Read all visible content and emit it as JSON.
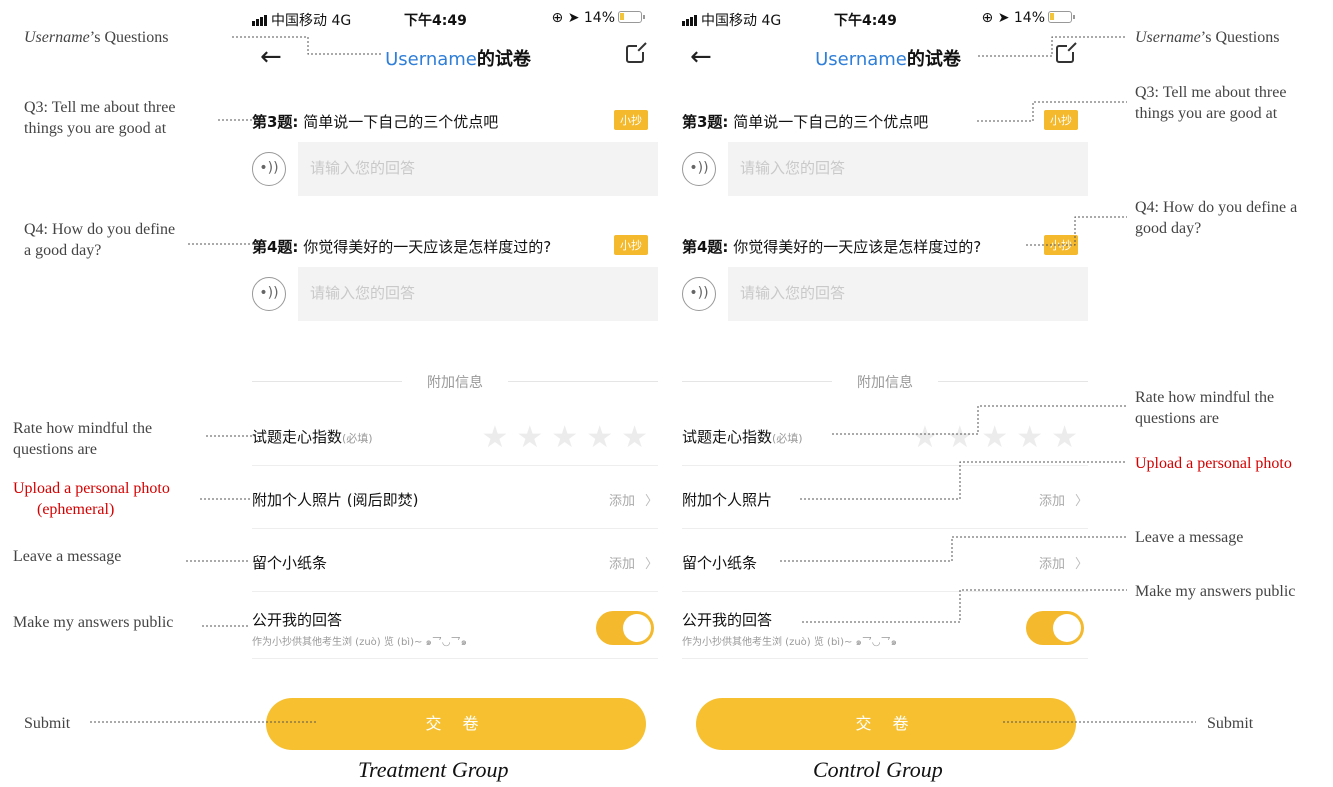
{
  "status_bar": {
    "carrier": "中国移动",
    "network": "4G",
    "time": "下午4:49",
    "battery": "14%",
    "icons": [
      "signal-icon",
      "lock-rotation-icon",
      "location-arrow-icon",
      "battery-icon"
    ]
  },
  "nav": {
    "back_icon": "arrow-left-icon",
    "title_username": "Username",
    "title_suffix": "的试卷",
    "share_icon": "share-icon"
  },
  "questions": [
    {
      "num": "第3题:",
      "text": "简单说一下自己的三个优点吧",
      "tag": "小抄",
      "placeholder": "请输入您的回答"
    },
    {
      "num": "第4题:",
      "text": "你觉得美好的一天应该是怎样度过的?",
      "tag": "小抄",
      "placeholder": "请输入您的回答"
    }
  ],
  "divider": "附加信息",
  "treatment": {
    "rating_label": "试题走心指数",
    "rating_required": "(必填)",
    "photo_label": "附加个人照片 (阅后即焚)",
    "photo_action": "添加",
    "message_label": "留个小纸条",
    "message_action": "添加",
    "public_label": "公开我的回答",
    "public_sub": "作为小抄供其他考生浏 (zuò) 览 (bì)~ ๑乛◡乛๑",
    "submit": "交 卷",
    "caption": "Treatment Group"
  },
  "control": {
    "rating_label": "试题走心指数",
    "rating_required": "(必填)",
    "photo_label": "附加个人照片",
    "photo_action": "添加",
    "message_label": "留个小纸条",
    "message_action": "添加",
    "public_label": "公开我的回答",
    "public_sub": "作为小抄供其他考生浏 (zuò) 览 (bì)~ ๑乛◡乛๑",
    "submit": "交 卷",
    "caption": "Control Group"
  },
  "annotations_left": {
    "title_italic": "Username",
    "title_rest": "’s Questions",
    "q3": "Q3: Tell me about three things you are good at",
    "q4": "Q4: How do you define a good day?",
    "rate": "Rate how mindful the questions are",
    "upload_line1": "Upload a personal photo",
    "upload_line2": "(ephemeral)",
    "message": "Leave a message",
    "public": "Make my answers public",
    "submit": "Submit"
  },
  "annotations_right": {
    "title_italic": "Username",
    "title_rest": "’s Questions",
    "q3": "Q3: Tell me about three things you are good at",
    "q4": "Q4: How do you define a good day?",
    "rate": "Rate how mindful the questions are",
    "upload": "Upload a personal photo",
    "message": "Leave a message",
    "public": "Make my answers public",
    "submit": "Submit"
  },
  "rating": {
    "max_stars": 5,
    "filled": 0
  },
  "toggle": {
    "on": true
  },
  "colors": {
    "accent": "#f4b92c",
    "link_blue": "#2f7ed8",
    "annotation_red": "#d40000"
  }
}
